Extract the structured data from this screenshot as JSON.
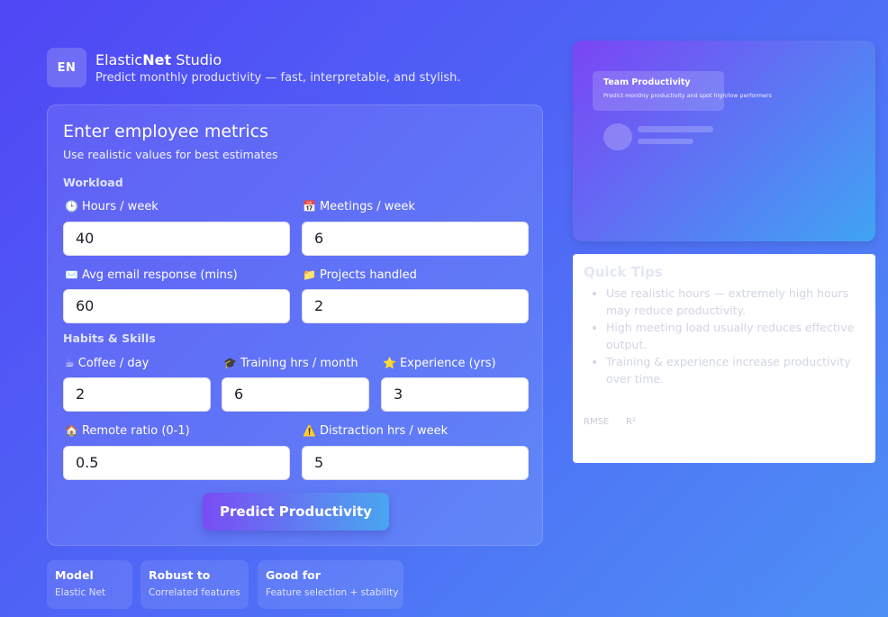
{
  "brand": {
    "logo": "EN",
    "title_prefix": "Elastic",
    "title_bold": "Net",
    "title_suffix": " Studio",
    "subtitle": "Predict monthly productivity — fast, interpretable, and stylish."
  },
  "form": {
    "title": "Enter employee metrics",
    "subtitle": "Use realistic values for best estimates",
    "sections": {
      "workload": "Workload",
      "habits": "Habits & Skills"
    },
    "fields": {
      "hours": {
        "icon": "🕒",
        "icon_name": "clock-icon",
        "label": "Hours / week",
        "value": "40"
      },
      "meetings": {
        "icon": "📅",
        "icon_name": "calendar-icon",
        "label": "Meetings / week",
        "value": "6"
      },
      "email": {
        "icon": "✉️",
        "icon_name": "envelope-icon",
        "label": "Avg email response (mins)",
        "value": "60"
      },
      "projects": {
        "icon": "📁",
        "icon_name": "folder-icon",
        "label": "Projects handled",
        "value": "2"
      },
      "coffee": {
        "icon": "☕",
        "icon_name": "coffee-icon",
        "label": "Coffee / day",
        "value": "2"
      },
      "training": {
        "icon": "🎓",
        "icon_name": "graduation-cap-icon",
        "label": "Training hrs / month",
        "value": "6"
      },
      "experience": {
        "icon": "⭐",
        "icon_name": "star-icon",
        "label": "Experience (yrs)",
        "value": "3"
      },
      "remote": {
        "icon": "🏠",
        "icon_name": "house-icon",
        "label": "Remote ratio (0-1)",
        "value": "0.5"
      },
      "distraction": {
        "icon": "⚠️",
        "icon_name": "warning-icon",
        "label": "Distraction hrs / week",
        "value": "5"
      }
    },
    "predict_label": "Predict Productivity"
  },
  "preview": {
    "title": "Team Productivity",
    "subtitle": "Predict monthly productivity and spot high/low performers"
  },
  "tips": {
    "title": "Quick Tips",
    "items": [
      "Use realistic hours — extremely high hours may reduce productivity.",
      "High meeting load usually reduces effective output.",
      "Training & experience increase productivity over time."
    ],
    "metric_rmse": "RMSE",
    "metric_r2": "R²"
  },
  "info": [
    {
      "label": "Model",
      "value": "Elastic Net"
    },
    {
      "label": "Robust to",
      "value": "Correlated features"
    },
    {
      "label": "Good for",
      "value": "Feature selection + stability"
    }
  ],
  "colors": {
    "background_start": "#5046f5",
    "background_end": "#4d90f5",
    "button_start": "#7a4cf4",
    "button_end": "#4aa6f0"
  }
}
